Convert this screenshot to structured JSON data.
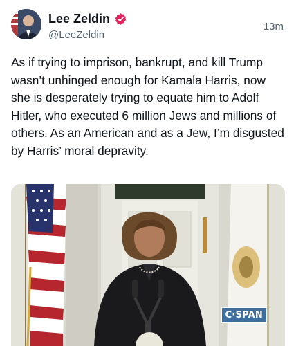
{
  "post": {
    "author": {
      "display_name": "Lee Zeldin",
      "handle": "@LeeZeldin",
      "verified": true,
      "verified_icon": "verified-badge-icon",
      "verified_color": "#e0245e"
    },
    "timestamp": "13m",
    "text": "As if trying to imprison, bankrupt, and kill Trump wasn’t unhinged enough for Kamala Harris, now she is desperately trying to equate him to Adolf Hitler, who executed 6 million Jews and millions of others. As an American and as a Jew, I’m disgusted by Harris’ moral depravity."
  },
  "media": {
    "watermark": "C·SPAN"
  }
}
